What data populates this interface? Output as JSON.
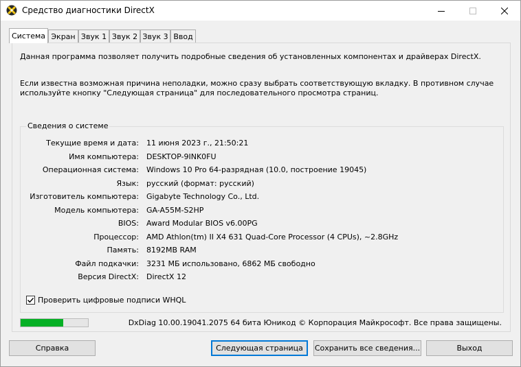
{
  "window": {
    "title": "Средство диагностики DirectX"
  },
  "titlebar": {
    "minimize": "—",
    "maximize": "☐",
    "close": "✕"
  },
  "tabs": [
    {
      "label": "Система",
      "active": true
    },
    {
      "label": "Экран"
    },
    {
      "label": "Звук 1"
    },
    {
      "label": "Звук 2"
    },
    {
      "label": "Звук 3"
    },
    {
      "label": "Ввод"
    }
  ],
  "panel": {
    "intro": "Данная программа позволяет получить подробные сведения об установленных компонентах и драйверах DirectX.",
    "help": "Если известна возможная причина неполадки, можно сразу выбрать соответствующую вкладку. В противном случае используйте кнопку \"Следующая страница\" для последовательного просмотра страниц.",
    "system_info": {
      "title": "Сведения о системе",
      "rows": [
        {
          "label": "Текущие время и дата:",
          "value": "11 июня 2023 г., 21:50:21"
        },
        {
          "label": "Имя компьютера:",
          "value": "DESKTOP-9INK0FU"
        },
        {
          "label": "Операционная система:",
          "value": "Windows 10 Pro 64-разрядная (10.0, построение 19045)"
        },
        {
          "label": "Язык:",
          "value": "русский (формат: русский)"
        },
        {
          "label": "Изготовитель компьютера:",
          "value": "Gigabyte Technology Co., Ltd."
        },
        {
          "label": "Модель компьютера:",
          "value": "GA-A55M-S2HP"
        },
        {
          "label": "BIOS:",
          "value": "Award Modular BIOS v6.00PG"
        },
        {
          "label": "Процессор:",
          "value": "AMD Athlon(tm) II X4 631 Quad-Core Processor (4 CPUs), ~2.8GHz"
        },
        {
          "label": "Память:",
          "value": "8192MB RAM"
        },
        {
          "label": "Файл подкачки:",
          "value": "3231 МБ использовано, 6862 МБ свободно"
        },
        {
          "label": "Версия DirectX:",
          "value": "DirectX 12"
        }
      ]
    },
    "whql": {
      "label": "Проверить цифровые подписи WHQL",
      "checked": true
    },
    "progress": 0.63,
    "footer": "DxDiag 10.00.19041.2075 64 бита Юникод  © Корпорация Майкрософт. Все права защищены."
  },
  "buttons": {
    "help": "Справка",
    "next": "Следующая страница",
    "save": "Сохранить все сведения...",
    "exit": "Выход"
  },
  "colors": {
    "accent": "#0078d7",
    "progress": "#06b025"
  }
}
